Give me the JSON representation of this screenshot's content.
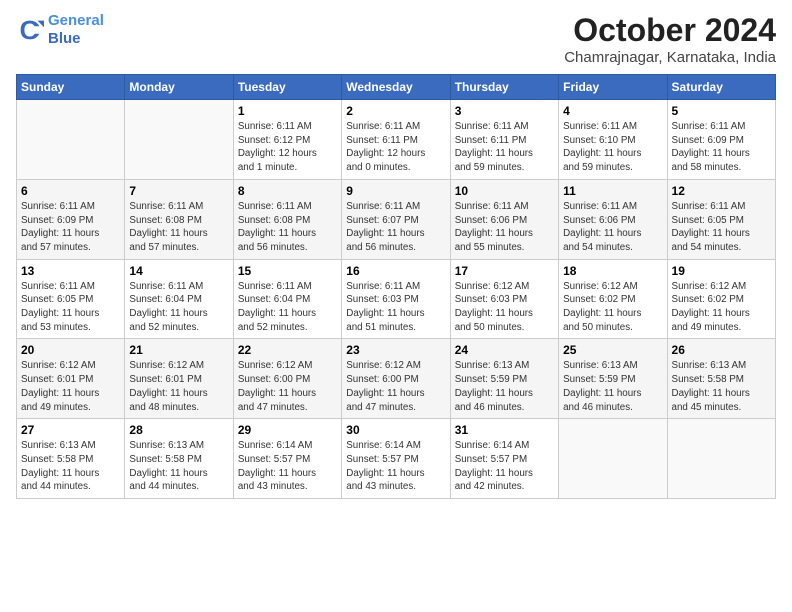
{
  "logo": {
    "line1": "General",
    "line2": "Blue"
  },
  "title": "October 2024",
  "subtitle": "Chamrajnagar, Karnataka, India",
  "weekdays": [
    "Sunday",
    "Monday",
    "Tuesday",
    "Wednesday",
    "Thursday",
    "Friday",
    "Saturday"
  ],
  "weeks": [
    [
      {
        "day": "",
        "info": ""
      },
      {
        "day": "",
        "info": ""
      },
      {
        "day": "1",
        "info": "Sunrise: 6:11 AM\nSunset: 6:12 PM\nDaylight: 12 hours\nand 1 minute."
      },
      {
        "day": "2",
        "info": "Sunrise: 6:11 AM\nSunset: 6:11 PM\nDaylight: 12 hours\nand 0 minutes."
      },
      {
        "day": "3",
        "info": "Sunrise: 6:11 AM\nSunset: 6:11 PM\nDaylight: 11 hours\nand 59 minutes."
      },
      {
        "day": "4",
        "info": "Sunrise: 6:11 AM\nSunset: 6:10 PM\nDaylight: 11 hours\nand 59 minutes."
      },
      {
        "day": "5",
        "info": "Sunrise: 6:11 AM\nSunset: 6:09 PM\nDaylight: 11 hours\nand 58 minutes."
      }
    ],
    [
      {
        "day": "6",
        "info": "Sunrise: 6:11 AM\nSunset: 6:09 PM\nDaylight: 11 hours\nand 57 minutes."
      },
      {
        "day": "7",
        "info": "Sunrise: 6:11 AM\nSunset: 6:08 PM\nDaylight: 11 hours\nand 57 minutes."
      },
      {
        "day": "8",
        "info": "Sunrise: 6:11 AM\nSunset: 6:08 PM\nDaylight: 11 hours\nand 56 minutes."
      },
      {
        "day": "9",
        "info": "Sunrise: 6:11 AM\nSunset: 6:07 PM\nDaylight: 11 hours\nand 56 minutes."
      },
      {
        "day": "10",
        "info": "Sunrise: 6:11 AM\nSunset: 6:06 PM\nDaylight: 11 hours\nand 55 minutes."
      },
      {
        "day": "11",
        "info": "Sunrise: 6:11 AM\nSunset: 6:06 PM\nDaylight: 11 hours\nand 54 minutes."
      },
      {
        "day": "12",
        "info": "Sunrise: 6:11 AM\nSunset: 6:05 PM\nDaylight: 11 hours\nand 54 minutes."
      }
    ],
    [
      {
        "day": "13",
        "info": "Sunrise: 6:11 AM\nSunset: 6:05 PM\nDaylight: 11 hours\nand 53 minutes."
      },
      {
        "day": "14",
        "info": "Sunrise: 6:11 AM\nSunset: 6:04 PM\nDaylight: 11 hours\nand 52 minutes."
      },
      {
        "day": "15",
        "info": "Sunrise: 6:11 AM\nSunset: 6:04 PM\nDaylight: 11 hours\nand 52 minutes."
      },
      {
        "day": "16",
        "info": "Sunrise: 6:11 AM\nSunset: 6:03 PM\nDaylight: 11 hours\nand 51 minutes."
      },
      {
        "day": "17",
        "info": "Sunrise: 6:12 AM\nSunset: 6:03 PM\nDaylight: 11 hours\nand 50 minutes."
      },
      {
        "day": "18",
        "info": "Sunrise: 6:12 AM\nSunset: 6:02 PM\nDaylight: 11 hours\nand 50 minutes."
      },
      {
        "day": "19",
        "info": "Sunrise: 6:12 AM\nSunset: 6:02 PM\nDaylight: 11 hours\nand 49 minutes."
      }
    ],
    [
      {
        "day": "20",
        "info": "Sunrise: 6:12 AM\nSunset: 6:01 PM\nDaylight: 11 hours\nand 49 minutes."
      },
      {
        "day": "21",
        "info": "Sunrise: 6:12 AM\nSunset: 6:01 PM\nDaylight: 11 hours\nand 48 minutes."
      },
      {
        "day": "22",
        "info": "Sunrise: 6:12 AM\nSunset: 6:00 PM\nDaylight: 11 hours\nand 47 minutes."
      },
      {
        "day": "23",
        "info": "Sunrise: 6:12 AM\nSunset: 6:00 PM\nDaylight: 11 hours\nand 47 minutes."
      },
      {
        "day": "24",
        "info": "Sunrise: 6:13 AM\nSunset: 5:59 PM\nDaylight: 11 hours\nand 46 minutes."
      },
      {
        "day": "25",
        "info": "Sunrise: 6:13 AM\nSunset: 5:59 PM\nDaylight: 11 hours\nand 46 minutes."
      },
      {
        "day": "26",
        "info": "Sunrise: 6:13 AM\nSunset: 5:58 PM\nDaylight: 11 hours\nand 45 minutes."
      }
    ],
    [
      {
        "day": "27",
        "info": "Sunrise: 6:13 AM\nSunset: 5:58 PM\nDaylight: 11 hours\nand 44 minutes."
      },
      {
        "day": "28",
        "info": "Sunrise: 6:13 AM\nSunset: 5:58 PM\nDaylight: 11 hours\nand 44 minutes."
      },
      {
        "day": "29",
        "info": "Sunrise: 6:14 AM\nSunset: 5:57 PM\nDaylight: 11 hours\nand 43 minutes."
      },
      {
        "day": "30",
        "info": "Sunrise: 6:14 AM\nSunset: 5:57 PM\nDaylight: 11 hours\nand 43 minutes."
      },
      {
        "day": "31",
        "info": "Sunrise: 6:14 AM\nSunset: 5:57 PM\nDaylight: 11 hours\nand 42 minutes."
      },
      {
        "day": "",
        "info": ""
      },
      {
        "day": "",
        "info": ""
      }
    ]
  ]
}
